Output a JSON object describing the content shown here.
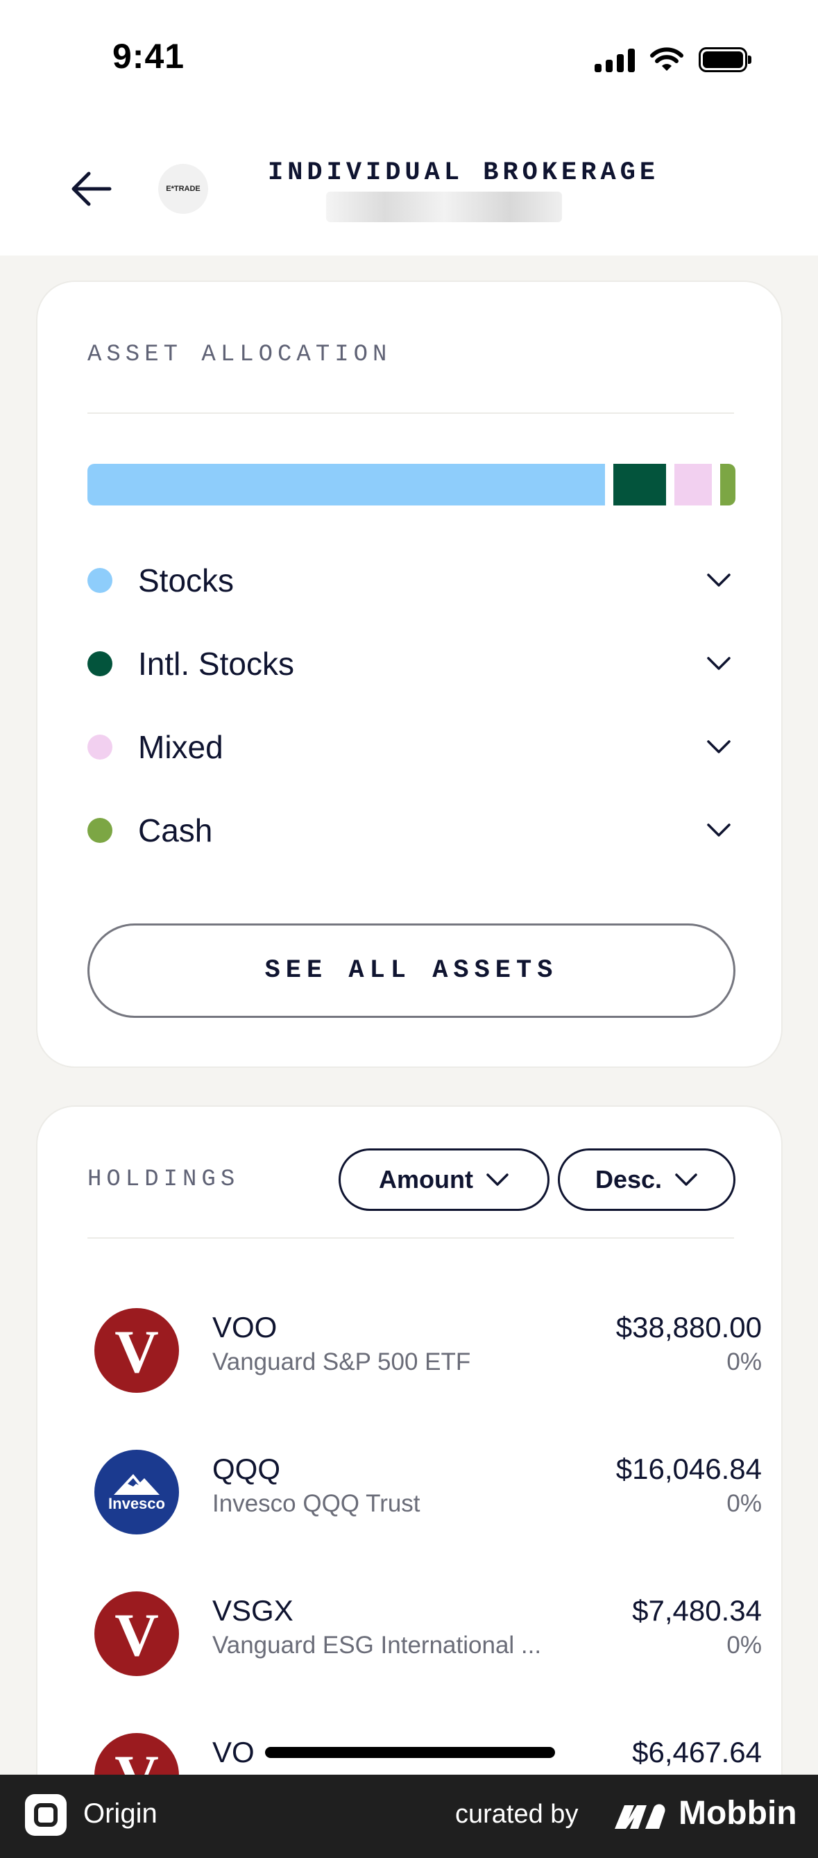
{
  "status_bar": {
    "time": "9:41"
  },
  "header": {
    "broker_logo_text": "E*TRADE",
    "title": "INDIVIDUAL BROKERAGE"
  },
  "asset_allocation": {
    "label": "ASSET ALLOCATION",
    "categories": [
      {
        "label": "Stocks",
        "color": "#8ECDFB",
        "share": 0.8
      },
      {
        "label": "Intl. Stocks",
        "color": "#03543C",
        "share": 0.08
      },
      {
        "label": "Mixed",
        "color": "#F2D0F0",
        "share": 0.06
      },
      {
        "label": "Cash",
        "color": "#7CA644",
        "share": 0.02
      }
    ],
    "see_all_label": "SEE ALL ASSETS"
  },
  "holdings": {
    "label": "HOLDINGS",
    "sort_field": "Amount",
    "sort_order": "Desc.",
    "items": [
      {
        "ticker": "VOO",
        "name": "Vanguard S&P 500 ETF",
        "value": "$38,880.00",
        "change": "0%",
        "logo": "vanguard-logo"
      },
      {
        "ticker": "QQQ",
        "name": "Invesco QQQ Trust",
        "value": "$16,046.84",
        "change": "0%",
        "logo": "invesco-logo",
        "logo_text": "Invesco"
      },
      {
        "ticker": "VSGX",
        "name": "Vanguard ESG International ...",
        "value": "$7,480.34",
        "change": "0%",
        "logo": "vanguard-logo"
      },
      {
        "ticker": "VO",
        "name": "",
        "value": "$6,467.64",
        "change": "",
        "logo": "vanguard-logo"
      }
    ]
  },
  "footer": {
    "app_name": "Origin",
    "curated_by": "curated by",
    "brand": "Mobbin"
  }
}
